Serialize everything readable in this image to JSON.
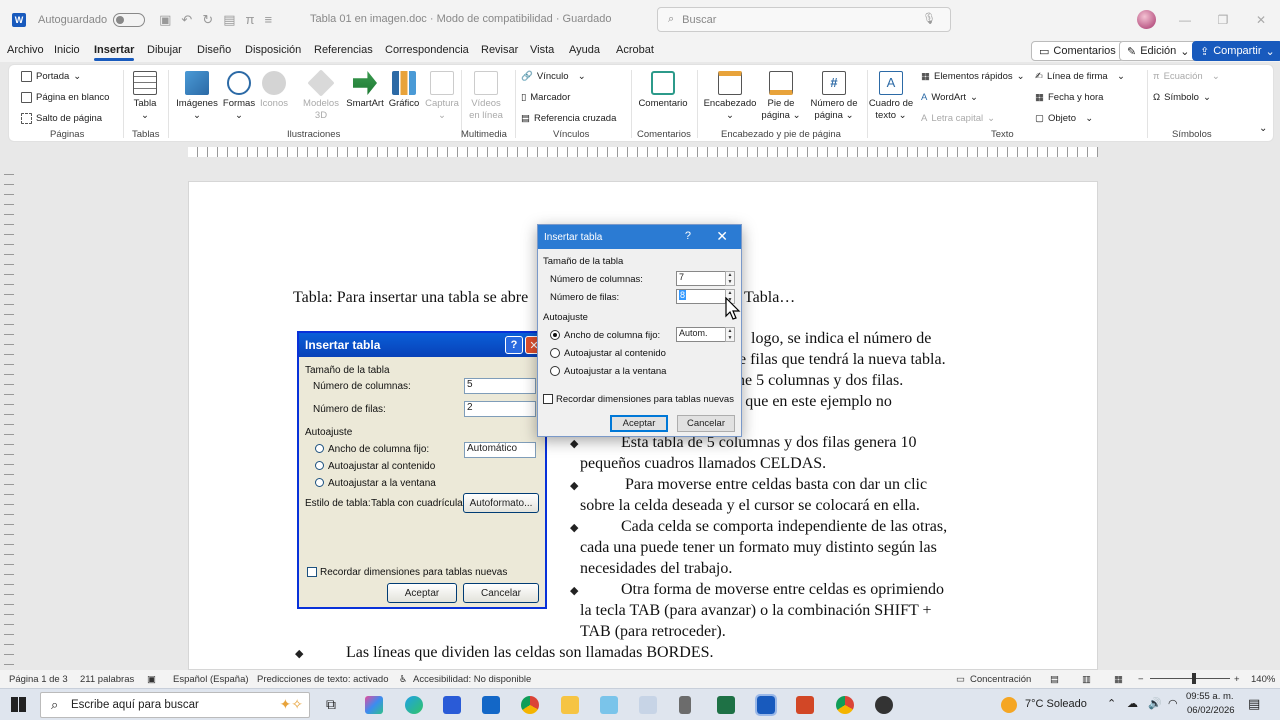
{
  "titlebar": {
    "app_letter": "W",
    "autosave": "Autoguardado",
    "doc_title": "Tabla 01 en imagen.doc  ·  Modo de compatibilidad  ·  Guardado",
    "search_placeholder": "Buscar"
  },
  "menu": {
    "items": [
      "Archivo",
      "Inicio",
      "Insertar",
      "Dibujar",
      "Diseño",
      "Disposición",
      "Referencias",
      "Correspondencia",
      "Revisar",
      "Vista",
      "Ayuda",
      "Acrobat"
    ],
    "active": "Insertar",
    "comments_btn": "Comentarios",
    "edit_btn": "Edición",
    "share_btn": "Compartir"
  },
  "ribbon": {
    "paginas": {
      "label": "Páginas",
      "items": [
        "Portada",
        "Página en blanco",
        "Salto de página"
      ]
    },
    "tablas": {
      "label": "Tablas",
      "button": "Tabla"
    },
    "ilustraciones": {
      "label": "Ilustraciones",
      "buttons": [
        "Imágenes",
        "Formas",
        "Iconos",
        "Modelos 3D",
        "SmartArt",
        "Gráfico",
        "Captura"
      ]
    },
    "multimedia": {
      "label": "Multimedia",
      "button_line1": "Vídeos",
      "button_line2": "en línea"
    },
    "vinculos": {
      "label": "Vínculos",
      "items": [
        "Vínculo",
        "Marcador",
        "Referencia cruzada"
      ]
    },
    "comentarios": {
      "label": "Comentarios",
      "button": "Comentario"
    },
    "encabezado": {
      "label": "Encabezado y pie de página",
      "buttons": [
        "Encabezado",
        "Pie de página",
        "Número de página"
      ]
    },
    "texto": {
      "label": "Texto",
      "cuadro_line1": "Cuadro de",
      "cuadro_line2": "texto",
      "items": [
        "Elementos rápidos",
        "WordArt",
        "Letra capital",
        "Línea de firma",
        "Fecha y hora",
        "Objeto"
      ]
    },
    "simbolos": {
      "label": "Símbolos",
      "items": [
        "Ecuación",
        "Símbolo"
      ]
    }
  },
  "document": {
    "heading": "Tabla: Para insertar una tabla se abre",
    "heading_tail": "Tabla…",
    "para_right": [
      "logo, se indica el número de",
      "e filas que tendrá la nueva tabla.",
      "ne 5 columnas y dos filas.",
      "s que en este ejemplo no"
    ],
    "bullets": [
      {
        "lines": [
          "Esta tabla de 5 columnas y dos filas genera 10",
          "pequeños cuadros llamados CELDAS."
        ]
      },
      {
        "lines": [
          "Para moverse entre celdas basta con dar un clic",
          "sobre la celda deseada y el cursor se colocará en ella."
        ]
      },
      {
        "lines": [
          "Cada celda se comporta independiente de las otras,",
          "cada una puede tener un formato muy distinto según las",
          "necesidades del trabajo."
        ]
      },
      {
        "lines": [
          "Otra forma de moverse entre celdas es oprimiendo",
          "la tecla TAB (para avanzar) o la combinación SHIFT +",
          "TAB (para retroceder)."
        ]
      }
    ],
    "bottom_bullet": "Las líneas que dividen las celdas son llamadas BORDES.",
    "bullet_glyph": "◆"
  },
  "old_dialog": {
    "title": "Insertar tabla",
    "size_label": "Tamaño de la tabla",
    "cols_label": "Número de columnas:",
    "cols_value": "5",
    "rows_label": "Número de filas:",
    "rows_value": "2",
    "autofit_label": "Autoajuste",
    "fixed_label": "Ancho de columna fijo:",
    "fixed_value": "Automático",
    "content_label": "Autoajustar al contenido",
    "window_label": "Autoajustar a la ventana",
    "style_label": "Estilo de tabla:",
    "style_value": "Tabla con cuadrícula",
    "autoformat_btn": "Autoformato...",
    "remember_label": "Recordar dimensiones para tablas nuevas",
    "ok_btn": "Aceptar",
    "cancel_btn": "Cancelar"
  },
  "dialog": {
    "title": "Insertar tabla",
    "help": "?",
    "size_label": "Tamaño de la tabla",
    "cols_label": "Número de columnas:",
    "cols_value": "7",
    "rows_label": "Número de filas:",
    "rows_value": "8",
    "autofit_label": "Autoajuste",
    "fixed_label": "Ancho de columna fijo:",
    "fixed_value": "Autom.",
    "content_label": "Autoajustar al contenido",
    "window_label": "Autoajustar a la ventana",
    "remember_label": "Recordar dimensiones para tablas nuevas",
    "ok_btn": "Aceptar",
    "cancel_btn": "Cancelar"
  },
  "status": {
    "page": "Página 1 de 3",
    "words": "211 palabras",
    "language": "Español (España)",
    "predictions": "Predicciones de texto: activado",
    "accessibility": "Accesibilidad: No disponible",
    "focus": "Concentración",
    "zoom": "140%"
  },
  "taskbar": {
    "search_placeholder": "Escribe aquí para buscar",
    "weather": "7°C  Soleado",
    "time": "09:55 a. m.",
    "date": "06/02/2026"
  }
}
